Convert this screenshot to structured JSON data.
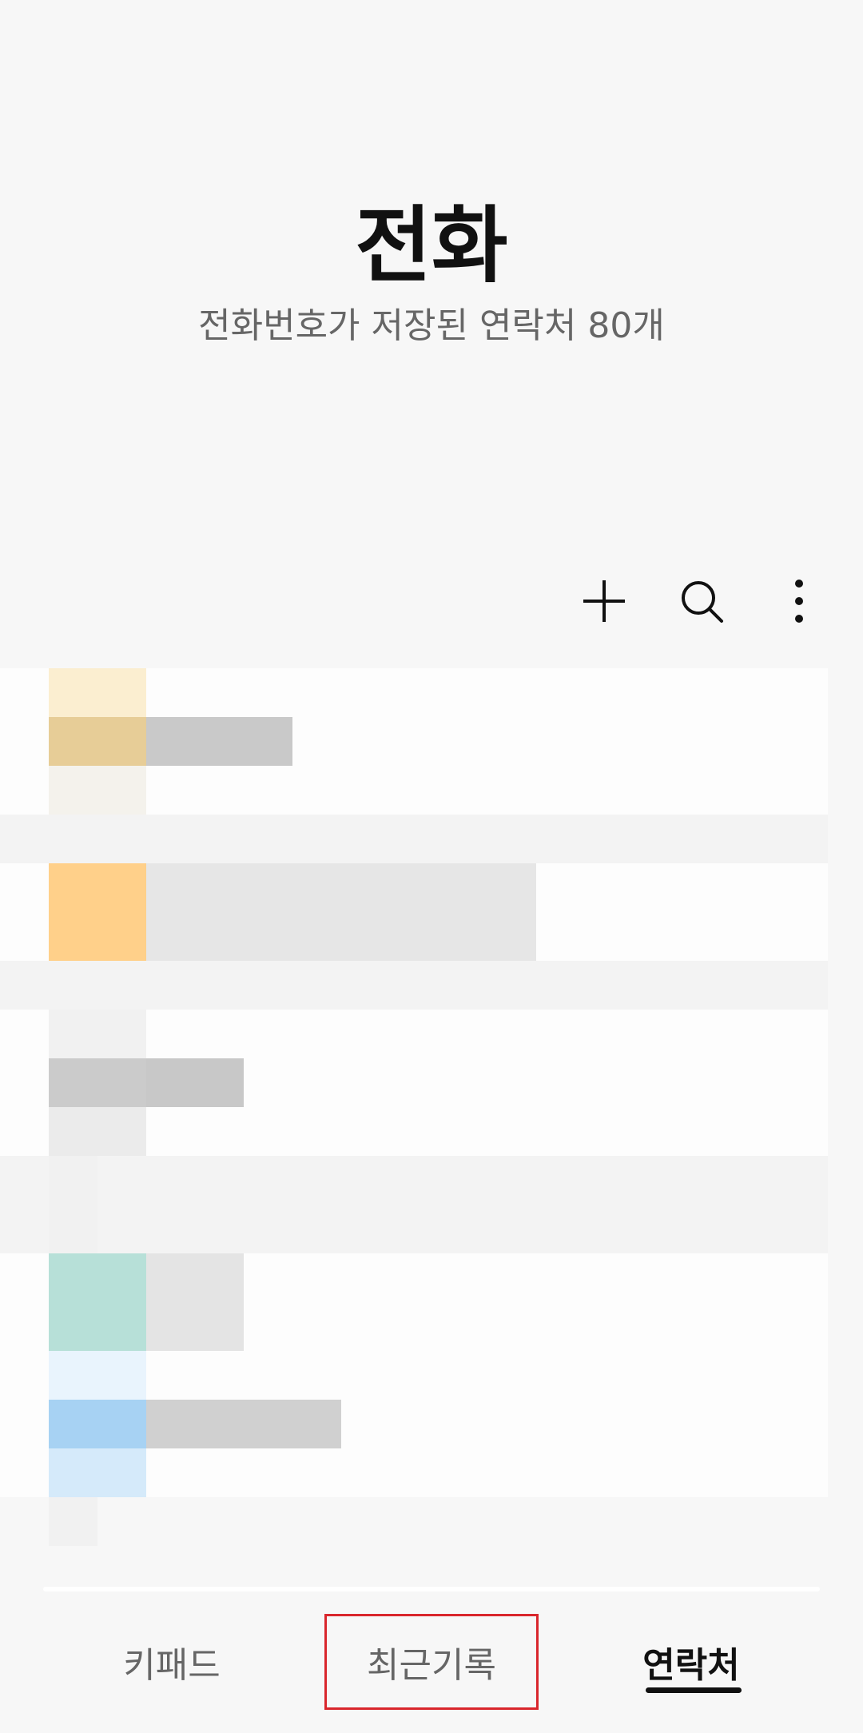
{
  "header": {
    "title": "전화",
    "subtitle": "전화번호가 저장된 연락처 80개"
  },
  "toolbar": {
    "add_icon": "plus-icon",
    "search_icon": "search-icon",
    "more_icon": "more-vertical-icon"
  },
  "bottom_nav": {
    "tabs": [
      {
        "label": "키패드",
        "active": false
      },
      {
        "label": "최근기록",
        "active": false
      },
      {
        "label": "연락처",
        "active": true
      }
    ]
  },
  "colors": {
    "background": "#f7f7f7",
    "active_tab": "#111111",
    "inactive_tab": "#666666",
    "highlight_border": "#d9262c",
    "avatar_yellow": "#f2d7a8",
    "avatar_orange": "#ffd08a",
    "avatar_gray": "#d3d3d3",
    "avatar_teal": "#b7e0d8",
    "avatar_blue": "#a7d2f3"
  }
}
